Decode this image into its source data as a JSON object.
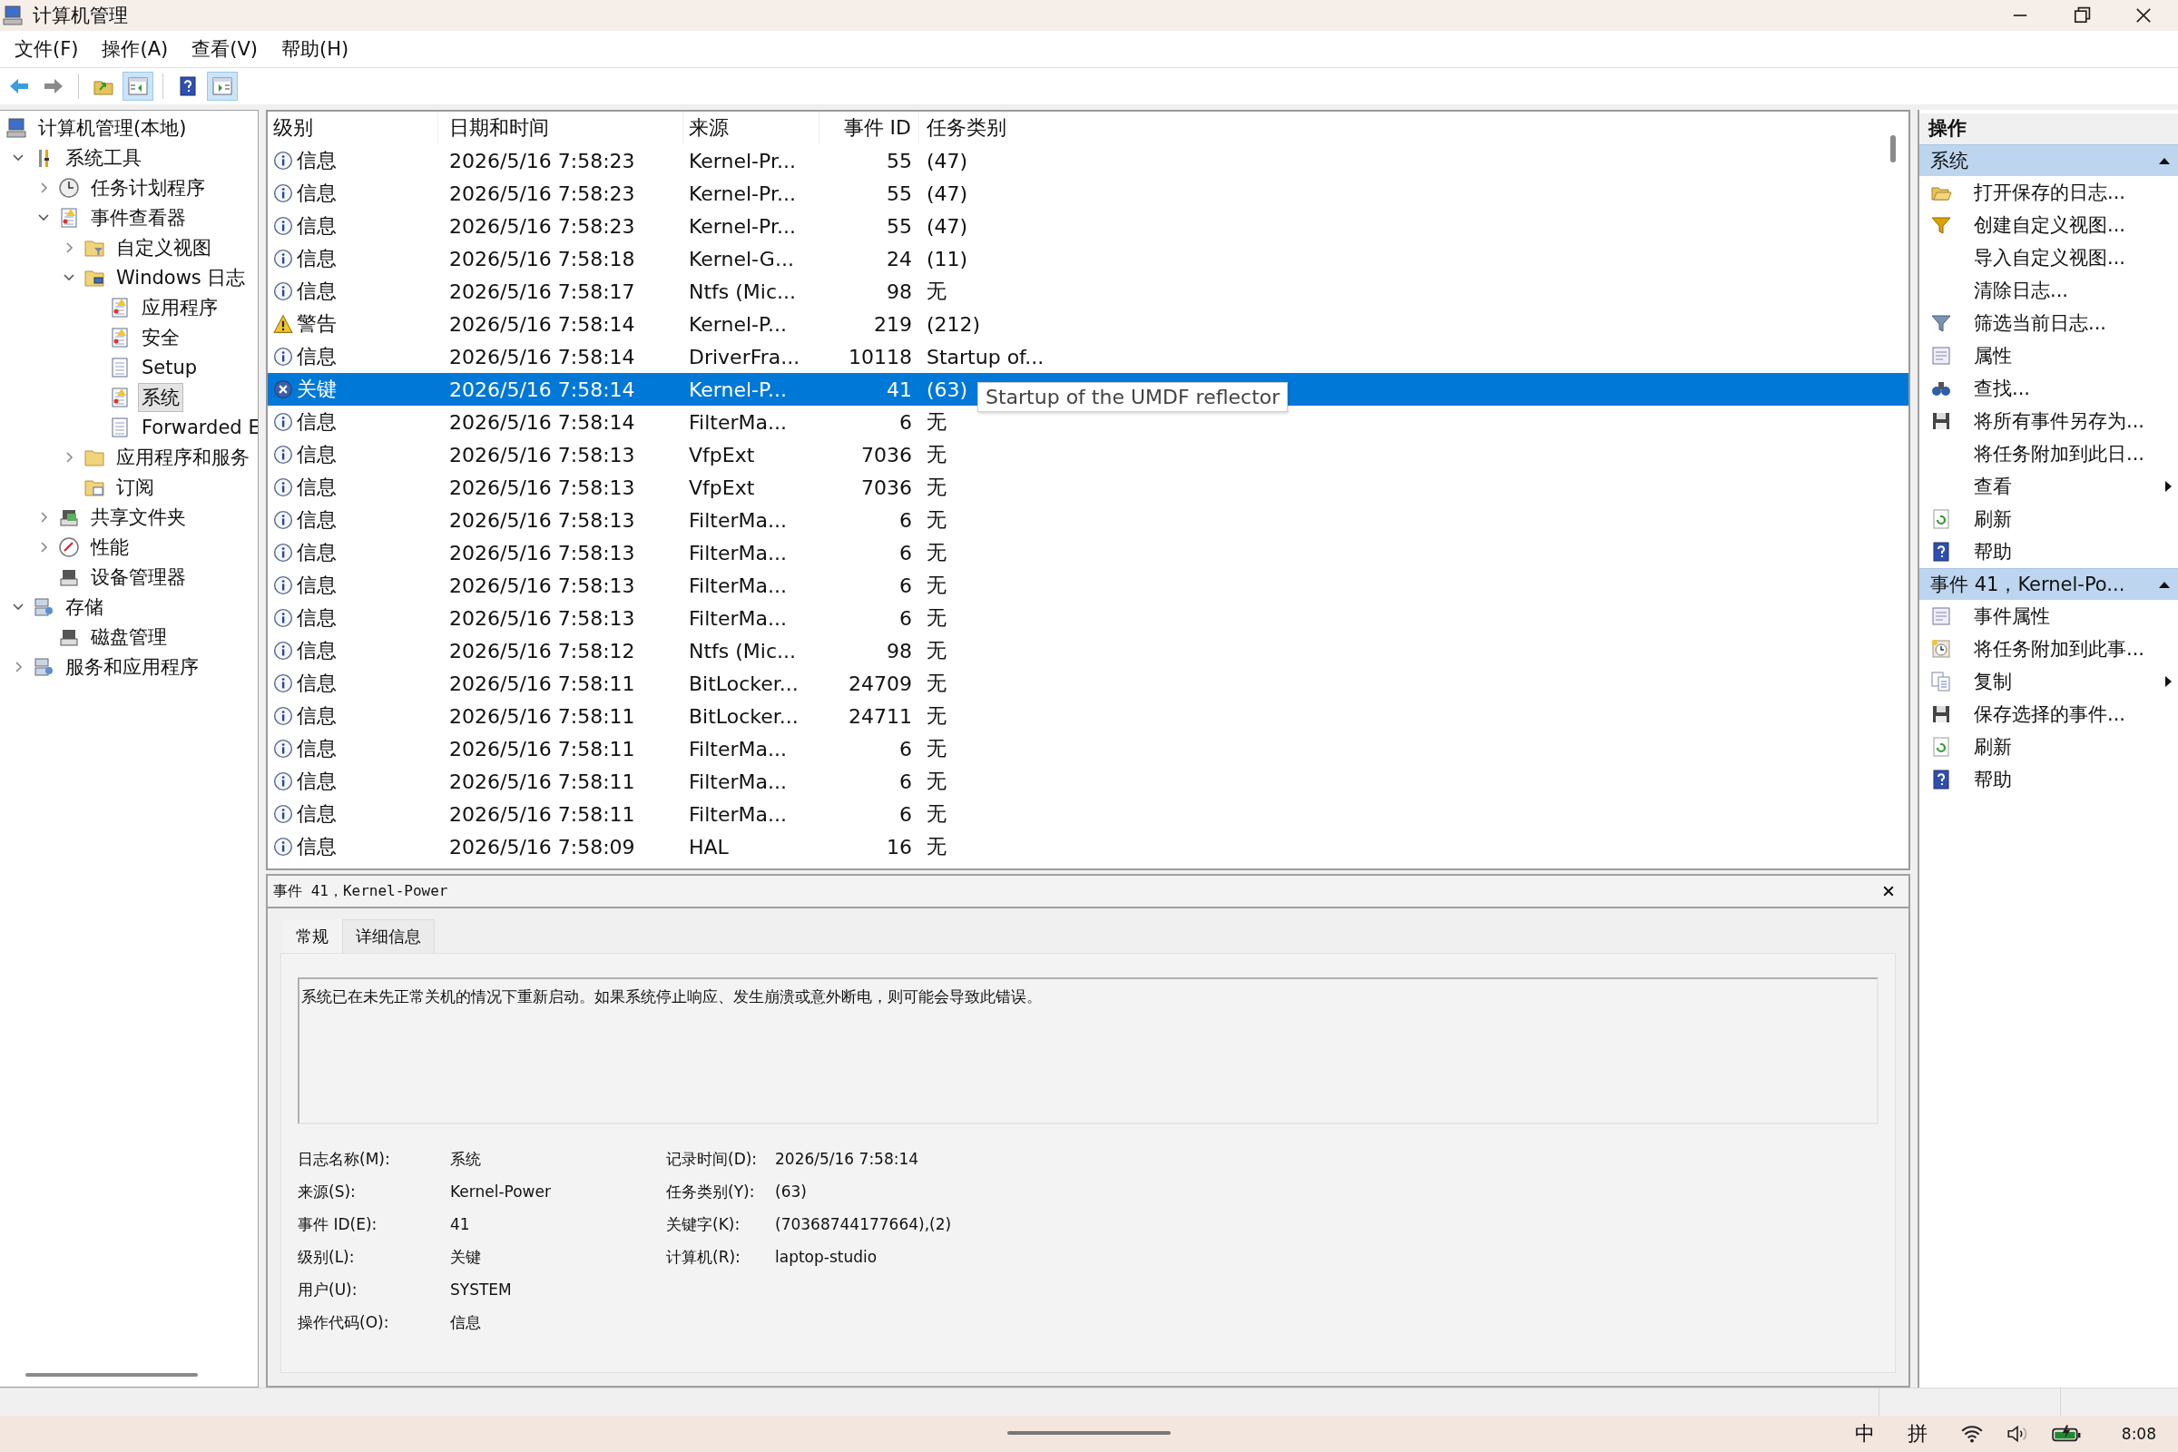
{
  "window": {
    "title": "计算机管理"
  },
  "menu": [
    "文件(F)",
    "操作(A)",
    "查看(V)",
    "帮助(H)"
  ],
  "toolbar": [
    {
      "kind": "back",
      "pressed": false
    },
    {
      "kind": "forward",
      "pressed": false
    },
    {
      "kind": "up-folder",
      "pressed": false
    },
    {
      "kind": "tree-pane",
      "pressed": true
    },
    {
      "kind": "help",
      "pressed": false
    },
    {
      "kind": "action-pane",
      "pressed": true
    }
  ],
  "tree": [
    {
      "label": "计算机管理(本地)",
      "kind": "computer",
      "expandable": false,
      "selected": false,
      "children": [
        {
          "label": "系统工具",
          "kind": "tools",
          "expandable": true,
          "expanded": true,
          "selected": false,
          "children": [
            {
              "label": "任务计划程序",
              "kind": "clock",
              "expandable": true,
              "expanded": false,
              "selected": false
            },
            {
              "label": "事件查看器",
              "kind": "log-warn",
              "expandable": true,
              "expanded": true,
              "selected": false,
              "children": [
                {
                  "label": "自定义视图",
                  "kind": "folder-filter",
                  "expandable": true,
                  "expanded": false,
                  "selected": false
                },
                {
                  "label": "Windows 日志",
                  "kind": "folder-computer",
                  "expandable": true,
                  "expanded": true,
                  "selected": false,
                  "children": [
                    {
                      "label": "应用程序",
                      "kind": "log-warn",
                      "expandable": false,
                      "expanded": false,
                      "selected": false
                    },
                    {
                      "label": "安全",
                      "kind": "log-warn",
                      "expandable": false,
                      "expanded": false,
                      "selected": false
                    },
                    {
                      "label": "Setup",
                      "kind": "log",
                      "expandable": false,
                      "expanded": false,
                      "selected": false
                    },
                    {
                      "label": "系统",
                      "kind": "log-warn",
                      "expandable": false,
                      "expanded": false,
                      "selected": true
                    },
                    {
                      "label": "Forwarded E",
                      "kind": "log",
                      "expandable": false,
                      "expanded": false,
                      "selected": false
                    }
                  ]
                },
                {
                  "label": "应用程序和服务",
                  "kind": "folder",
                  "expandable": true,
                  "expanded": false,
                  "selected": false
                },
                {
                  "label": "订阅",
                  "kind": "folder-calendar",
                  "expandable": false,
                  "expanded": false,
                  "selected": false
                }
              ]
            },
            {
              "label": "共享文件夹",
              "kind": "shared",
              "expandable": true,
              "expanded": false,
              "selected": false
            },
            {
              "label": "性能",
              "kind": "gauge",
              "expandable": true,
              "expanded": false,
              "selected": false
            },
            {
              "label": "设备管理器",
              "kind": "device",
              "expandable": false,
              "expanded": false,
              "selected": false
            }
          ]
        },
        {
          "label": "存储",
          "kind": "storage",
          "expandable": true,
          "expanded": true,
          "selected": false,
          "children": [
            {
              "label": "磁盘管理",
              "kind": "disk",
              "expandable": false,
              "expanded": false,
              "selected": false
            }
          ]
        },
        {
          "label": "服务和应用程序",
          "kind": "services",
          "expandable": true,
          "expanded": false,
          "selected": false
        }
      ]
    }
  ],
  "table": {
    "columns": [
      "级别",
      "日期和时间",
      "来源",
      "事件 ID",
      "任务类别"
    ],
    "rows": [
      {
        "kind": "info",
        "level": "信息",
        "datetime": "2026/5/16 7:58:23",
        "source": "Kernel-Pr...",
        "event_id": "55",
        "task_category": "(47)",
        "selected": false
      },
      {
        "kind": "info",
        "level": "信息",
        "datetime": "2026/5/16 7:58:23",
        "source": "Kernel-Pr...",
        "event_id": "55",
        "task_category": "(47)",
        "selected": false
      },
      {
        "kind": "info",
        "level": "信息",
        "datetime": "2026/5/16 7:58:23",
        "source": "Kernel-Pr...",
        "event_id": "55",
        "task_category": "(47)",
        "selected": false
      },
      {
        "kind": "info",
        "level": "信息",
        "datetime": "2026/5/16 7:58:18",
        "source": "Kernel-G...",
        "event_id": "24",
        "task_category": "(11)",
        "selected": false
      },
      {
        "kind": "info",
        "level": "信息",
        "datetime": "2026/5/16 7:58:17",
        "source": "Ntfs (Mic...",
        "event_id": "98",
        "task_category": "无",
        "selected": false
      },
      {
        "kind": "warning",
        "level": "警告",
        "datetime": "2026/5/16 7:58:14",
        "source": "Kernel-P...",
        "event_id": "219",
        "task_category": "(212)",
        "selected": false
      },
      {
        "kind": "info",
        "level": "信息",
        "datetime": "2026/5/16 7:58:14",
        "source": "DriverFra...",
        "event_id": "10118",
        "task_category": "Startup of...",
        "selected": false
      },
      {
        "kind": "critical",
        "level": "关键",
        "datetime": "2026/5/16 7:58:14",
        "source": "Kernel-P...",
        "event_id": "41",
        "task_category": "(63)",
        "selected": true
      },
      {
        "kind": "info",
        "level": "信息",
        "datetime": "2026/5/16 7:58:14",
        "source": "FilterMa...",
        "event_id": "6",
        "task_category": "无",
        "selected": false
      },
      {
        "kind": "info",
        "level": "信息",
        "datetime": "2026/5/16 7:58:13",
        "source": "VfpExt",
        "event_id": "7036",
        "task_category": "无",
        "selected": false
      },
      {
        "kind": "info",
        "level": "信息",
        "datetime": "2026/5/16 7:58:13",
        "source": "VfpExt",
        "event_id": "7036",
        "task_category": "无",
        "selected": false
      },
      {
        "kind": "info",
        "level": "信息",
        "datetime": "2026/5/16 7:58:13",
        "source": "FilterMa...",
        "event_id": "6",
        "task_category": "无",
        "selected": false
      },
      {
        "kind": "info",
        "level": "信息",
        "datetime": "2026/5/16 7:58:13",
        "source": "FilterMa...",
        "event_id": "6",
        "task_category": "无",
        "selected": false
      },
      {
        "kind": "info",
        "level": "信息",
        "datetime": "2026/5/16 7:58:13",
        "source": "FilterMa...",
        "event_id": "6",
        "task_category": "无",
        "selected": false
      },
      {
        "kind": "info",
        "level": "信息",
        "datetime": "2026/5/16 7:58:13",
        "source": "FilterMa...",
        "event_id": "6",
        "task_category": "无",
        "selected": false
      },
      {
        "kind": "info",
        "level": "信息",
        "datetime": "2026/5/16 7:58:12",
        "source": "Ntfs (Mic...",
        "event_id": "98",
        "task_category": "无",
        "selected": false
      },
      {
        "kind": "info",
        "level": "信息",
        "datetime": "2026/5/16 7:58:11",
        "source": "BitLocker...",
        "event_id": "24709",
        "task_category": "无",
        "selected": false
      },
      {
        "kind": "info",
        "level": "信息",
        "datetime": "2026/5/16 7:58:11",
        "source": "BitLocker...",
        "event_id": "24711",
        "task_category": "无",
        "selected": false
      },
      {
        "kind": "info",
        "level": "信息",
        "datetime": "2026/5/16 7:58:11",
        "source": "FilterMa...",
        "event_id": "6",
        "task_category": "无",
        "selected": false
      },
      {
        "kind": "info",
        "level": "信息",
        "datetime": "2026/5/16 7:58:11",
        "source": "FilterMa...",
        "event_id": "6",
        "task_category": "无",
        "selected": false
      },
      {
        "kind": "info",
        "level": "信息",
        "datetime": "2026/5/16 7:58:11",
        "source": "FilterMa...",
        "event_id": "6",
        "task_category": "无",
        "selected": false
      },
      {
        "kind": "info",
        "level": "信息",
        "datetime": "2026/5/16 7:58:09",
        "source": "HAL",
        "event_id": "16",
        "task_category": "无",
        "selected": false
      }
    ],
    "tooltip": "Startup of the UMDF reflector"
  },
  "details": {
    "title": "事件 41，Kernel-Power",
    "tabs": [
      {
        "label": "常规",
        "selected": true
      },
      {
        "label": "详细信息",
        "selected": false
      }
    ],
    "description": "系统已在未先正常关机的情况下重新启动。如果系统停止响应、发生崩溃或意外断电，则可能会导致此错误。",
    "fields_left": [
      {
        "label": "日志名称(M):",
        "value": "系统"
      },
      {
        "label": "来源(S):",
        "value": "Kernel-Power"
      },
      {
        "label": "事件 ID(E):",
        "value": "41"
      },
      {
        "label": "级别(L):",
        "value": "关键"
      },
      {
        "label": "用户(U):",
        "value": "SYSTEM"
      },
      {
        "label": "操作代码(O):",
        "value": "信息"
      }
    ],
    "fields_right": [
      {
        "label": "记录时间(D):",
        "value": "2026/5/16 7:58:14"
      },
      {
        "label": "任务类别(Y):",
        "value": "(63)"
      },
      {
        "label": "关键字(K):",
        "value": "(70368744177664),(2)"
      },
      {
        "label": "计算机(R):",
        "value": "laptop-studio"
      }
    ]
  },
  "actions": {
    "title": "操作",
    "sections": [
      {
        "title": "系统",
        "expanded": true,
        "items": [
          {
            "label": "打开保存的日志...",
            "kind": "open-folder",
            "submenu": false
          },
          {
            "label": "创建自定义视图...",
            "kind": "filter-gold",
            "submenu": false
          },
          {
            "label": "导入自定义视图...",
            "kind": "none",
            "submenu": false
          },
          {
            "label": "清除日志...",
            "kind": "none",
            "submenu": false
          },
          {
            "label": "筛选当前日志...",
            "kind": "filter",
            "submenu": false
          },
          {
            "label": "属性",
            "kind": "properties",
            "submenu": false
          },
          {
            "label": "查找...",
            "kind": "binoculars",
            "submenu": false
          },
          {
            "label": "将所有事件另存为...",
            "kind": "save",
            "submenu": false
          },
          {
            "label": "将任务附加到此日...",
            "kind": "none",
            "submenu": false
          },
          {
            "label": "查看",
            "kind": "none",
            "submenu": true
          },
          {
            "label": "刷新",
            "kind": "refresh",
            "submenu": false
          },
          {
            "label": "帮助",
            "kind": "help",
            "submenu": false
          }
        ]
      },
      {
        "title": "事件 41，Kernel-Po...",
        "expanded": true,
        "items": [
          {
            "label": "事件属性",
            "kind": "properties",
            "submenu": false
          },
          {
            "label": "将任务附加到此事...",
            "kind": "task",
            "submenu": false
          },
          {
            "label": "复制",
            "kind": "copy",
            "submenu": true
          },
          {
            "label": "保存选择的事件...",
            "kind": "save",
            "submenu": false
          },
          {
            "label": "刷新",
            "kind": "refresh",
            "submenu": false
          },
          {
            "label": "帮助",
            "kind": "help",
            "submenu": false
          }
        ]
      }
    ]
  },
  "taskbar": {
    "tray": [
      "中",
      "拼"
    ],
    "clock": "8:08"
  }
}
